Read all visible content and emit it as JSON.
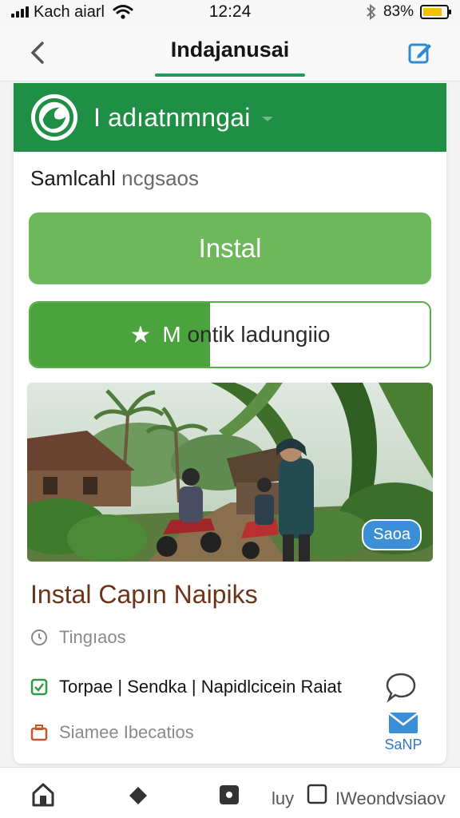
{
  "status_bar": {
    "carrier": "Kach aiarl",
    "time": "12:24",
    "battery": "83%",
    "battery_level": 0.83
  },
  "top_nav": {
    "title": "Indajanusai"
  },
  "header": {
    "title": "I adıatnmngai"
  },
  "search": {
    "label_main": "Samlcahl",
    "label_muted": "ncgsaos"
  },
  "install_button": {
    "label": "Instal"
  },
  "progress_button": {
    "label_prefix": "M",
    "label": "ontik ladungiio",
    "progress": 0.45
  },
  "photo": {
    "badge": "Saoa"
  },
  "article": {
    "title": "Instal Capın Naipiks",
    "meta_time": "Tingıaos",
    "meta_details": "Torpae | Sendka | Napidlcicein Raiat",
    "meta_share": "Siamee Ibecatios",
    "mail_label": "SaNP"
  },
  "bottom_nav": {
    "item_text_1": "luy",
    "item_text_2": "IWeondvsiaov"
  },
  "colors": {
    "brand_green": "#1e8f44",
    "install_green": "#6cb85a",
    "title_brown": "#6b3318",
    "accent_blue": "#3b8fd6"
  }
}
